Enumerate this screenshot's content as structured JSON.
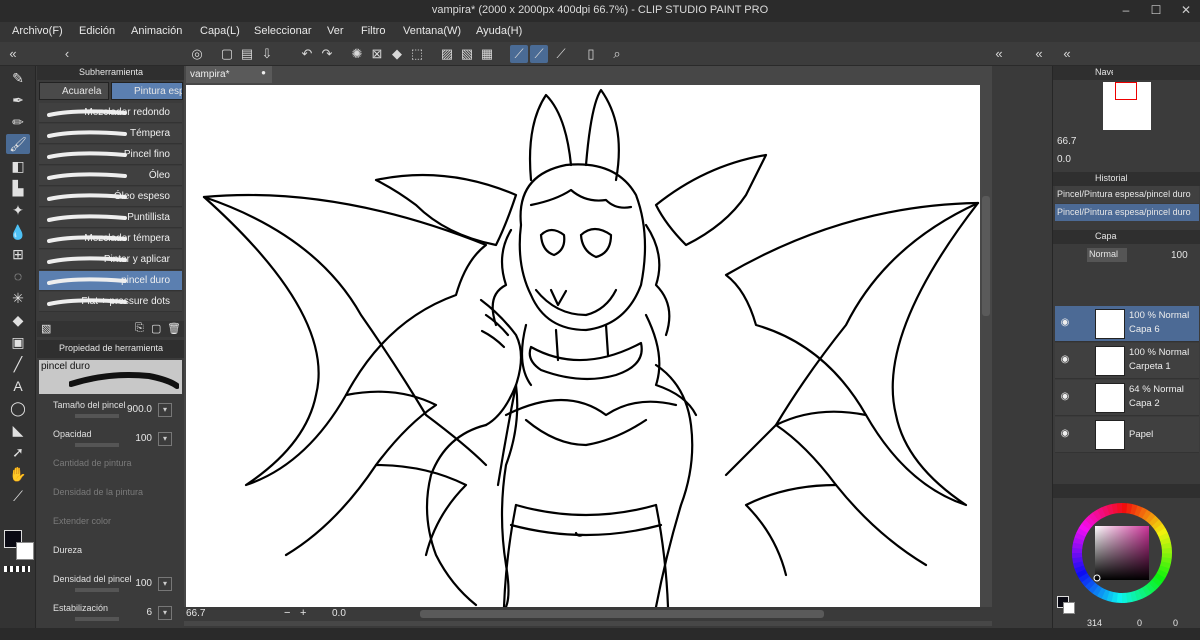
{
  "window": {
    "title": "vampira* (2000 x 2000px 400dpi 66.7%)  - CLIP STUDIO PAINT PRO",
    "minimize": "–",
    "maximize": "☐",
    "close": "✕"
  },
  "menu": [
    "Archivo(F)",
    "Edición",
    "Animación",
    "Capa(L)",
    "Seleccionar",
    "Ver",
    "Filtro",
    "Ventana(W)",
    "Ayuda(H)"
  ],
  "subtool": {
    "panel_title": "Subherramienta",
    "tabs": [
      "Acuarela",
      "Pintura esp"
    ],
    "brushes": [
      "Mezclador redondo",
      "Témpera",
      "Pincel fino",
      "Óleo",
      "Óleo espeso",
      "Puntillista",
      "Mezclador témpera",
      "Pintar y aplicar",
      "pincel duro",
      "Flat + pressure dots"
    ],
    "selected_index": 8
  },
  "toolprop": {
    "panel_title": "Propiedad de herramienta",
    "preset_name": "pincel duro",
    "rows": [
      {
        "label": "Tamaño del pincel",
        "value": "900.0",
        "enabled": true
      },
      {
        "label": "Opacidad",
        "value": "100",
        "enabled": true
      },
      {
        "label": "Cantidad de pintura",
        "value": "",
        "enabled": false
      },
      {
        "label": "Densidad de la pintura",
        "value": "",
        "enabled": false
      },
      {
        "label": "Extender color",
        "value": "",
        "enabled": false
      },
      {
        "label": "Dureza",
        "value": "",
        "enabled": true
      },
      {
        "label": "Densidad del pincel",
        "value": "100",
        "enabled": true
      },
      {
        "label": "Estabilización",
        "value": "6",
        "enabled": true
      }
    ]
  },
  "canvas": {
    "tab_name": "vampira*",
    "zoom": "66.7",
    "rotation": "0.0"
  },
  "navigator": {
    "title": "Navegador",
    "zoom": "66.7",
    "angle": "0.0"
  },
  "history": {
    "title": "Historial",
    "items": [
      "Pincel/Pintura espesa/pincel duro",
      "Pincel/Pintura espesa/pincel duro"
    ]
  },
  "layers": {
    "title": "Capa",
    "blend_mode": "Normal",
    "opacity": "100",
    "items": [
      {
        "mode": "100 % Normal",
        "name": "Capa 6",
        "active": true
      },
      {
        "mode": "100 % Normal",
        "name": "Carpeta 1",
        "active": false
      },
      {
        "mode": "64 % Normal",
        "name": "Capa 2",
        "active": false
      },
      {
        "mode": "",
        "name": "Papel",
        "active": false
      }
    ]
  },
  "color": {
    "main": "#0a0a14",
    "sub": "#ffffff",
    "hue_selected": "#cc3399"
  },
  "status": {
    "nav_a": "314",
    "nav_b": "0",
    "nav_c": "0"
  }
}
